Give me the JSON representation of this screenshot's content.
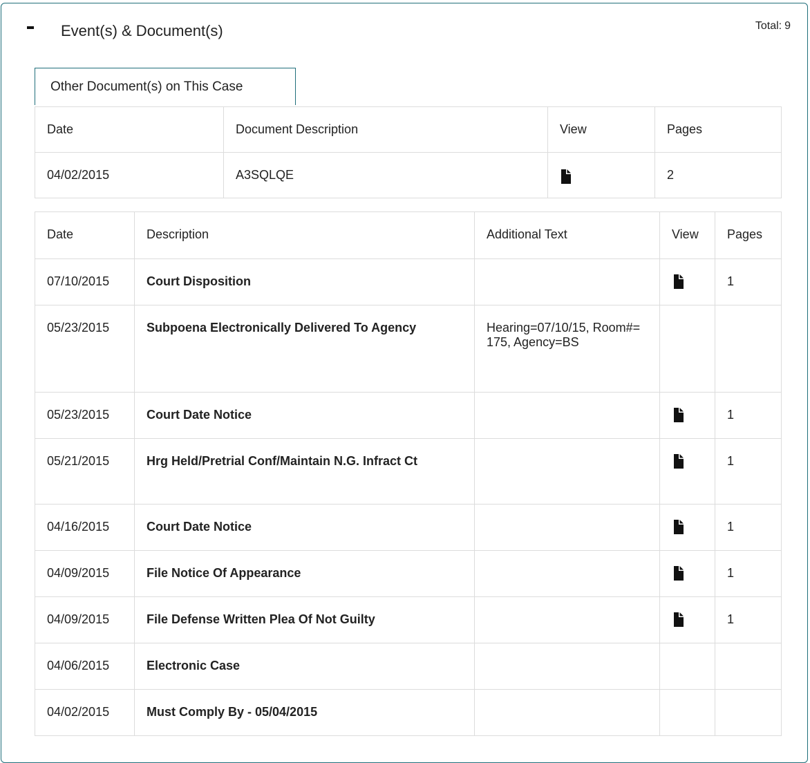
{
  "panel": {
    "title": "Event(s) & Document(s)",
    "total_label": "Total:",
    "total_value": "9"
  },
  "other_docs": {
    "button_label": "Other Document(s) on This Case",
    "headers": {
      "date": "Date",
      "description": "Document Description",
      "view": "View",
      "pages": "Pages"
    },
    "rows": [
      {
        "date": "04/02/2015",
        "description": "A3SQLQE",
        "has_document": true,
        "pages": "2"
      }
    ]
  },
  "events": {
    "headers": {
      "date": "Date",
      "description": "Description",
      "additional_text": "Additional Text",
      "view": "View",
      "pages": "Pages"
    },
    "rows": [
      {
        "date": "07/10/2015",
        "description": "Court Disposition",
        "additional_text": "",
        "has_document": true,
        "pages": "1"
      },
      {
        "date": "05/23/2015",
        "description": "Subpoena Electronically Delivered To Agency",
        "additional_text": "Hearing=07/10/15, Room#= 175, Agency=BS",
        "has_document": false,
        "pages": ""
      },
      {
        "date": "05/23/2015",
        "description": "Court Date Notice",
        "additional_text": "",
        "has_document": true,
        "pages": "1"
      },
      {
        "date": "05/21/2015",
        "description": "Hrg Held/Pretrial Conf/Maintain N.G. Infract Ct",
        "additional_text": "",
        "has_document": true,
        "pages": "1"
      },
      {
        "date": "04/16/2015",
        "description": "Court Date Notice",
        "additional_text": "",
        "has_document": true,
        "pages": "1"
      },
      {
        "date": "04/09/2015",
        "description": "File Notice Of Appearance",
        "additional_text": "",
        "has_document": true,
        "pages": "1"
      },
      {
        "date": "04/09/2015",
        "description": "File Defense Written Plea Of Not Guilty",
        "additional_text": "",
        "has_document": true,
        "pages": "1"
      },
      {
        "date": "04/06/2015",
        "description": "Electronic Case",
        "additional_text": "",
        "has_document": false,
        "pages": ""
      },
      {
        "date": "04/02/2015",
        "description": "Must Comply By - 05/04/2015",
        "additional_text": "",
        "has_document": false,
        "pages": ""
      }
    ]
  },
  "icons": {
    "collapse": "minus-icon",
    "document": "document-icon"
  },
  "colors": {
    "accent_border": "#1f6e7a",
    "table_border": "#dcdcdc"
  }
}
